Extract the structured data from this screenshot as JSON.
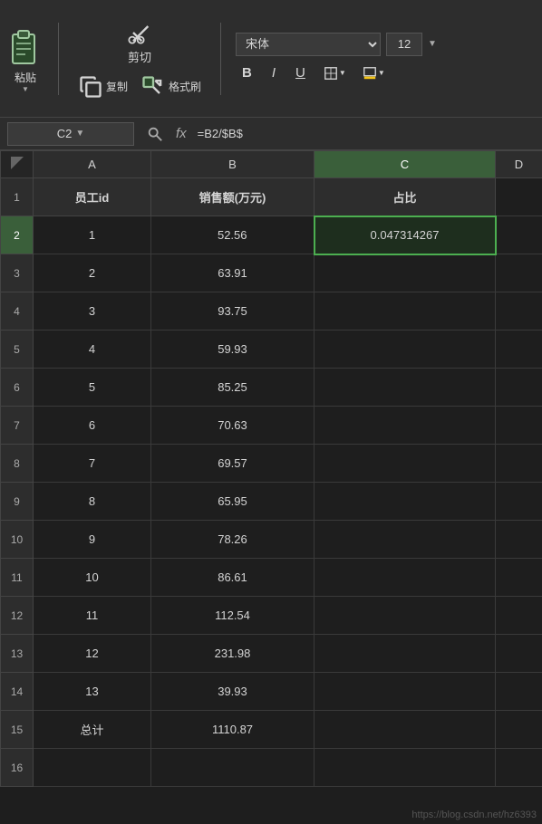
{
  "toolbar": {
    "paste_label": "粘贴",
    "cut_label": "剪切",
    "copy_label": "复制",
    "format_painter_label": "格式刷",
    "font_name": "宋体",
    "font_size": "12",
    "bold_label": "B",
    "italic_label": "I",
    "underline_label": "U"
  },
  "formula_bar": {
    "cell_ref": "C2",
    "formula": "=B2/$B$"
  },
  "spreadsheet": {
    "col_headers": [
      "",
      "A",
      "B",
      "C",
      "D"
    ],
    "rows": [
      {
        "row_num": "1",
        "a": "员工id",
        "b": "销售额(万元)",
        "c": "占比",
        "d": ""
      },
      {
        "row_num": "2",
        "a": "1",
        "b": "52.56",
        "c": "0.047314267",
        "d": ""
      },
      {
        "row_num": "3",
        "a": "2",
        "b": "63.91",
        "c": "",
        "d": ""
      },
      {
        "row_num": "4",
        "a": "3",
        "b": "93.75",
        "c": "",
        "d": ""
      },
      {
        "row_num": "5",
        "a": "4",
        "b": "59.93",
        "c": "",
        "d": ""
      },
      {
        "row_num": "6",
        "a": "5",
        "b": "85.25",
        "c": "",
        "d": ""
      },
      {
        "row_num": "7",
        "a": "6",
        "b": "70.63",
        "c": "",
        "d": ""
      },
      {
        "row_num": "8",
        "a": "7",
        "b": "69.57",
        "c": "",
        "d": ""
      },
      {
        "row_num": "9",
        "a": "8",
        "b": "65.95",
        "c": "",
        "d": ""
      },
      {
        "row_num": "10",
        "a": "9",
        "b": "78.26",
        "c": "",
        "d": ""
      },
      {
        "row_num": "11",
        "a": "10",
        "b": "86.61",
        "c": "",
        "d": ""
      },
      {
        "row_num": "12",
        "a": "11",
        "b": "112.54",
        "c": "",
        "d": ""
      },
      {
        "row_num": "13",
        "a": "12",
        "b": "231.98",
        "c": "",
        "d": ""
      },
      {
        "row_num": "14",
        "a": "13",
        "b": "39.93",
        "c": "",
        "d": ""
      },
      {
        "row_num": "15",
        "a": "总计",
        "b": "1110.87",
        "c": "",
        "d": ""
      },
      {
        "row_num": "16",
        "a": "",
        "b": "",
        "c": "",
        "d": ""
      }
    ]
  },
  "watermark": "https://blog.csdn.net/hz6393"
}
